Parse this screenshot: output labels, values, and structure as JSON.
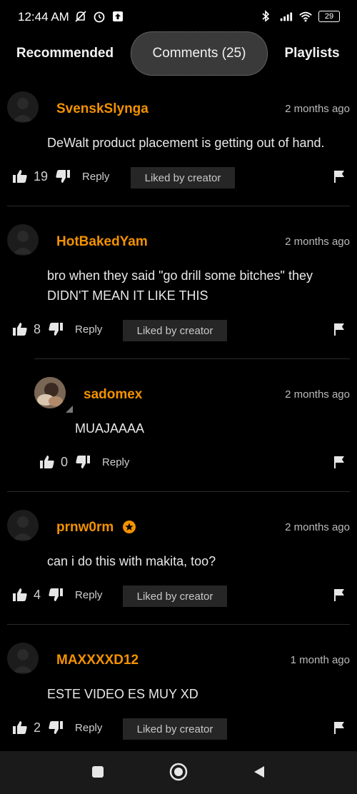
{
  "status": {
    "time": "12:44 AM",
    "battery": "29",
    "icons_left": [
      "mute-icon",
      "alarm-icon",
      "upload-icon"
    ],
    "icons_right": [
      "bluetooth-icon",
      "signal-icon",
      "wifi-icon",
      "battery-icon"
    ]
  },
  "tabs": {
    "recommended": "Recommended",
    "comments": "Comments (25)",
    "playlists": "Playlists"
  },
  "comments": [
    {
      "username": "SvenskSlynga",
      "time": "2 months ago",
      "text": "DeWalt product placement is getting out of hand.",
      "likes": "19",
      "reply": "Reply",
      "liked_by": "Liked by creator"
    },
    {
      "username": "HotBakedYam",
      "time": "2 months ago",
      "text_line1": "bro when they said \"go drill some bitches\" they",
      "text_line2": "DIDN'T MEAN IT LIKE THIS",
      "likes": "8",
      "reply": "Reply",
      "liked_by": "Liked by creator"
    },
    {
      "username": "sadomex",
      "time": "2 months ago",
      "text": "MUAJAAAA",
      "likes": "0",
      "reply": "Reply"
    },
    {
      "username": "prnw0rm",
      "time": "2 months ago",
      "text": "can i do this with makita, too?",
      "likes": "4",
      "reply": "Reply",
      "liked_by": "Liked by creator"
    },
    {
      "username": "MAXXXXD12",
      "time": "1 month ago",
      "text": "ESTE VIDEO ES MUY XD",
      "likes": "2",
      "reply": "Reply",
      "liked_by": "Liked by creator"
    }
  ],
  "colors": {
    "accent": "#f39200",
    "background": "#000000",
    "chip": "#262626"
  }
}
